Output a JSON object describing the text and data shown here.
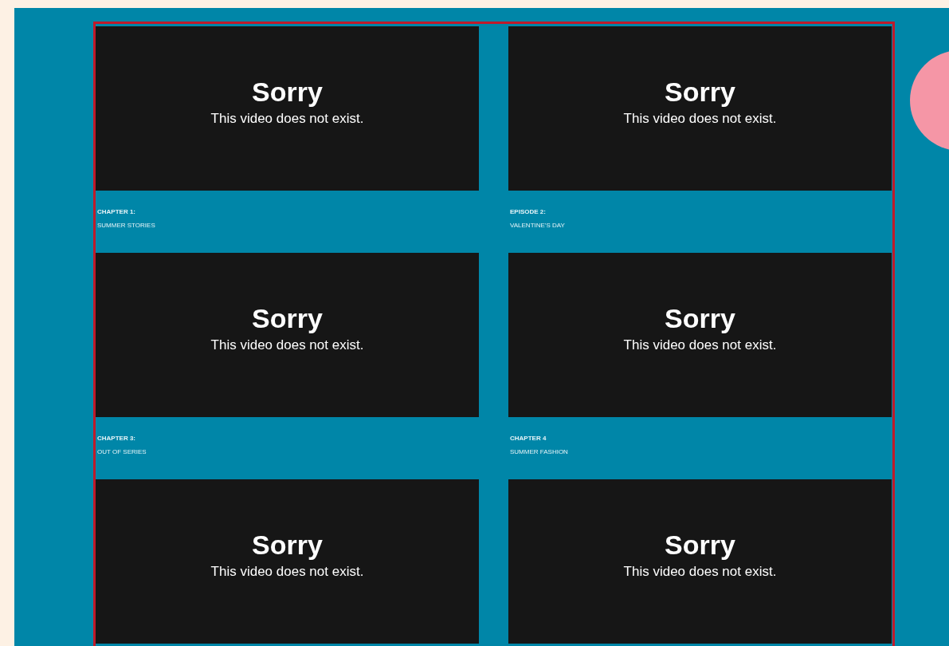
{
  "videos": [
    {
      "title": "Sorry",
      "message": "This video does not exist.",
      "caption": {
        "title": "CHAPTER 1:",
        "subtitle": "SUMMER STORIES"
      }
    },
    {
      "title": "Sorry",
      "message": "This video does not exist.",
      "caption": {
        "title": "EPISODE 2:",
        "subtitle": "VALENTINE'S DAY"
      }
    },
    {
      "title": "Sorry",
      "message": "This video does not exist.",
      "caption": {
        "title": "CHAPTER 3:",
        "subtitle": "OUT OF SERIES"
      }
    },
    {
      "title": "Sorry",
      "message": "This video does not exist.",
      "caption": {
        "title": "CHAPTER 4",
        "subtitle": "SUMMER FASHION"
      }
    },
    {
      "title": "Sorry",
      "message": "This video does not exist."
    },
    {
      "title": "Sorry",
      "message": "This video does not exist."
    }
  ]
}
